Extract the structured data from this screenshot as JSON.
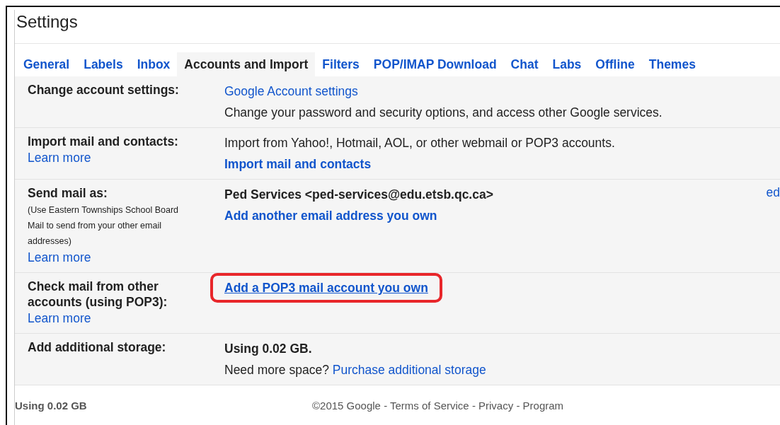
{
  "title": "Settings",
  "tabs": [
    {
      "label": "General",
      "selected": false
    },
    {
      "label": "Labels",
      "selected": false
    },
    {
      "label": "Inbox",
      "selected": false
    },
    {
      "label": "Accounts and Import",
      "selected": true
    },
    {
      "label": "Filters",
      "selected": false
    },
    {
      "label": "POP/IMAP Download",
      "selected": false
    },
    {
      "label": "Chat",
      "selected": false
    },
    {
      "label": "Labs",
      "selected": false
    },
    {
      "label": "Offline",
      "selected": false
    },
    {
      "label": "Themes",
      "selected": false
    }
  ],
  "sections": [
    {
      "label": "Change account settings:",
      "lines": [
        {
          "kind": "link",
          "text": "Google Account settings",
          "highlighted": false
        },
        {
          "kind": "text",
          "text": "Change your password and security options, and access other Google services."
        }
      ]
    },
    {
      "label": "Import mail and contacts:",
      "learn_more": "Learn more",
      "lines": [
        {
          "kind": "text",
          "text": "Import from Yahoo!, Hotmail, AOL, or other webmail or POP3 accounts."
        },
        {
          "kind": "strong-link",
          "text": "Import mail and contacts",
          "highlighted": false
        }
      ]
    },
    {
      "label": "Send mail as:",
      "note": "(Use Eastern Townships School Board Mail to send from your other email addresses)",
      "learn_more": "Learn more",
      "side_link": "ed",
      "lines": [
        {
          "kind": "strong",
          "text": "Ped Services <ped-services@edu.etsb.qc.ca>"
        },
        {
          "kind": "strong-link",
          "text": "Add another email address you own",
          "highlighted": false
        }
      ]
    },
    {
      "label": "Check mail from other accounts (using POP3):",
      "learn_more": "Learn more",
      "lines": [
        {
          "kind": "strong-link",
          "text": "Add a POP3 mail account you own",
          "highlighted": true
        }
      ]
    },
    {
      "label": "Add additional storage:",
      "lines": [
        {
          "kind": "strong",
          "text": "Using 0.02 GB."
        },
        {
          "kind": "text-link",
          "text": "Need more space?",
          "link": "Purchase additional storage"
        }
      ]
    }
  ],
  "footer": {
    "usage": "Using 0.02 GB",
    "copyright": "©2015 Google - Terms of Service - Privacy - Program"
  }
}
